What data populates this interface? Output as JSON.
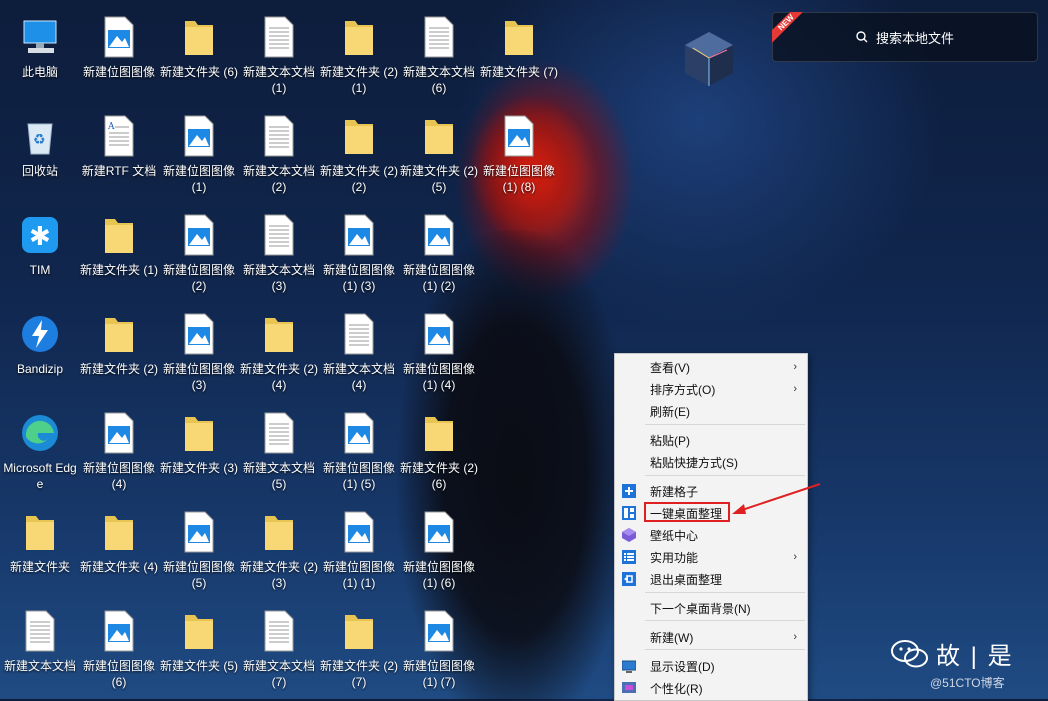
{
  "desktop": {
    "icons": [
      {
        "label": "此电脑",
        "type": "pc"
      },
      {
        "label": "回收站",
        "type": "recycle"
      },
      {
        "label": "TIM",
        "type": "tim"
      },
      {
        "label": "Bandizip",
        "type": "bandizip"
      },
      {
        "label": "Microsoft Edge",
        "type": "edge"
      },
      {
        "label": "新建文件夹",
        "type": "folder"
      },
      {
        "label": "新建文本文档",
        "type": "text"
      },
      {
        "label": "新建位图图像",
        "type": "image"
      },
      {
        "label": "新建RTF 文档",
        "type": "rtf"
      },
      {
        "label": "新建文件夹 (1)",
        "type": "folder"
      },
      {
        "label": "新建文件夹 (2)",
        "type": "folder"
      },
      {
        "label": "新建位图图像 (4)",
        "type": "image"
      },
      {
        "label": "新建文件夹 (4)",
        "type": "folder"
      },
      {
        "label": "新建位图图像 (6)",
        "type": "image"
      },
      {
        "label": "新建文件夹 (6)",
        "type": "folder"
      },
      {
        "label": "新建位图图像 (1)",
        "type": "image"
      },
      {
        "label": "新建位图图像 (2)",
        "type": "image"
      },
      {
        "label": "新建位图图像 (3)",
        "type": "image"
      },
      {
        "label": "新建文件夹 (3)",
        "type": "folder"
      },
      {
        "label": "新建位图图像 (5)",
        "type": "image"
      },
      {
        "label": "新建文件夹 (5)",
        "type": "folder"
      },
      {
        "label": "新建文本文档 (1)",
        "type": "text"
      },
      {
        "label": "新建文本文档 (2)",
        "type": "text"
      },
      {
        "label": "新建文本文档 (3)",
        "type": "text"
      },
      {
        "label": "新建文件夹 (2) (4)",
        "type": "folder"
      },
      {
        "label": "新建文本文档 (5)",
        "type": "text"
      },
      {
        "label": "新建文件夹 (2) (3)",
        "type": "folder"
      },
      {
        "label": "新建文本文档 (7)",
        "type": "text"
      },
      {
        "label": "新建文件夹 (2) (1)",
        "type": "folder"
      },
      {
        "label": "新建文件夹 (2) (2)",
        "type": "folder"
      },
      {
        "label": "新建位图图像 (1) (3)",
        "type": "image"
      },
      {
        "label": "新建文本文档 (4)",
        "type": "text"
      },
      {
        "label": "新建位图图像 (1) (5)",
        "type": "image"
      },
      {
        "label": "新建位图图像 (1) (1)",
        "type": "image"
      },
      {
        "label": "新建文件夹 (2) (7)",
        "type": "folder"
      },
      {
        "label": "新建文本文档 (6)",
        "type": "text"
      },
      {
        "label": "新建文件夹 (2) (5)",
        "type": "folder"
      },
      {
        "label": "新建位图图像 (1) (2)",
        "type": "image"
      },
      {
        "label": "新建位图图像 (1) (4)",
        "type": "image"
      },
      {
        "label": "新建文件夹 (2) (6)",
        "type": "folder"
      },
      {
        "label": "新建位图图像 (1) (6)",
        "type": "image"
      },
      {
        "label": "新建位图图像 (1) (7)",
        "type": "image"
      },
      {
        "label": "新建文件夹 (7)",
        "type": "folder"
      },
      {
        "label": "新建位图图像 (1) (8)",
        "type": "image"
      }
    ]
  },
  "search": {
    "label": "搜索本地文件",
    "badge": "NEW"
  },
  "context_menu": {
    "items": [
      {
        "label": "查看(V)",
        "submenu": true,
        "icon": ""
      },
      {
        "label": "排序方式(O)",
        "submenu": true,
        "icon": ""
      },
      {
        "label": "刷新(E)",
        "submenu": false,
        "icon": ""
      },
      {
        "label": "粘贴(P)",
        "submenu": false,
        "icon": ""
      },
      {
        "label": "粘贴快捷方式(S)",
        "submenu": false,
        "icon": ""
      },
      {
        "label": "新建格子",
        "submenu": false,
        "icon": "plus-icon"
      },
      {
        "label": "一键桌面整理",
        "submenu": false,
        "icon": "layout-icon"
      },
      {
        "label": "壁纸中心",
        "submenu": false,
        "icon": "cube-icon"
      },
      {
        "label": "实用功能",
        "submenu": true,
        "icon": "list-icon"
      },
      {
        "label": "退出桌面整理",
        "submenu": false,
        "icon": "exit-icon"
      },
      {
        "label": "下一个桌面背景(N)",
        "submenu": false,
        "icon": ""
      },
      {
        "label": "新建(W)",
        "submenu": true,
        "icon": ""
      },
      {
        "label": "显示设置(D)",
        "submenu": false,
        "icon": "display-icon"
      },
      {
        "label": "个性化(R)",
        "submenu": false,
        "icon": "personalize-icon"
      }
    ]
  },
  "watermark": {
    "title": "故 | 是",
    "sub": "@51CTO博客"
  },
  "colors": {
    "accent": "#1e73d8",
    "annotation": "#e02020"
  }
}
